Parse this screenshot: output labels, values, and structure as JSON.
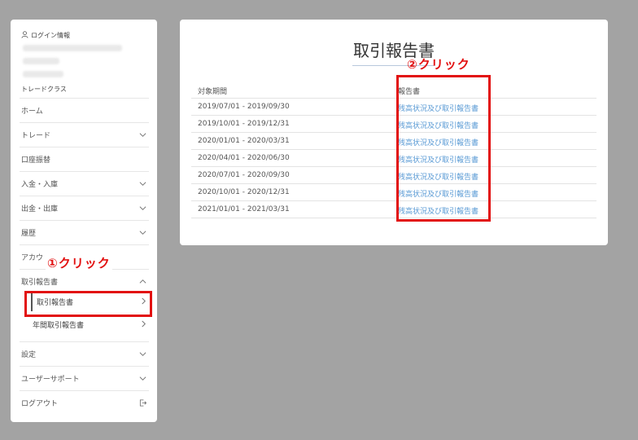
{
  "sidebar": {
    "login_label": "ログイン情報",
    "trade_class_label": "トレードクラス",
    "items": [
      {
        "label": "ホーム",
        "chevron": false
      },
      {
        "label": "トレード",
        "chevron": true
      },
      {
        "label": "口座振替",
        "chevron": false
      },
      {
        "label": "入金・入庫",
        "chevron": true
      },
      {
        "label": "出金・出庫",
        "chevron": true
      },
      {
        "label": "履歴",
        "chevron": true
      },
      {
        "label": "アカウ",
        "chevron": false
      },
      {
        "label": "取引報告書",
        "chevron": "up"
      }
    ],
    "subitems": [
      {
        "label": "取引報告書",
        "active": true
      },
      {
        "label": "年間取引報告書",
        "active": false
      }
    ],
    "bottom_items": [
      {
        "label": "設定",
        "icon": "chevron-down-icon"
      },
      {
        "label": "ユーザーサポート",
        "icon": "chevron-down-icon"
      },
      {
        "label": "ログアウト",
        "icon": "logout-icon"
      }
    ]
  },
  "main": {
    "title": "取引報告書",
    "columns": [
      "対象期間",
      "報告書"
    ],
    "rows": [
      {
        "period": "2019/07/01 - 2019/09/30",
        "report": "残高状況及び取引報告書"
      },
      {
        "period": "2019/10/01 - 2019/12/31",
        "report": "残高状況及び取引報告書"
      },
      {
        "period": "2020/01/01 - 2020/03/31",
        "report": "残高状況及び取引報告書"
      },
      {
        "period": "2020/04/01 - 2020/06/30",
        "report": "残高状況及び取引報告書"
      },
      {
        "period": "2020/07/01 - 2020/09/30",
        "report": "残高状況及び取引報告書"
      },
      {
        "period": "2020/10/01 - 2020/12/31",
        "report": "残高状況及び取引報告書"
      },
      {
        "period": "2021/01/01 - 2021/03/31",
        "report": "残高状況及び取引報告書"
      }
    ]
  },
  "annotations": {
    "step1": "①クリック",
    "step2": "②クリック",
    "color": "#e21010"
  },
  "colors": {
    "background": "#a3a3a3",
    "link": "#5b9bd5"
  }
}
